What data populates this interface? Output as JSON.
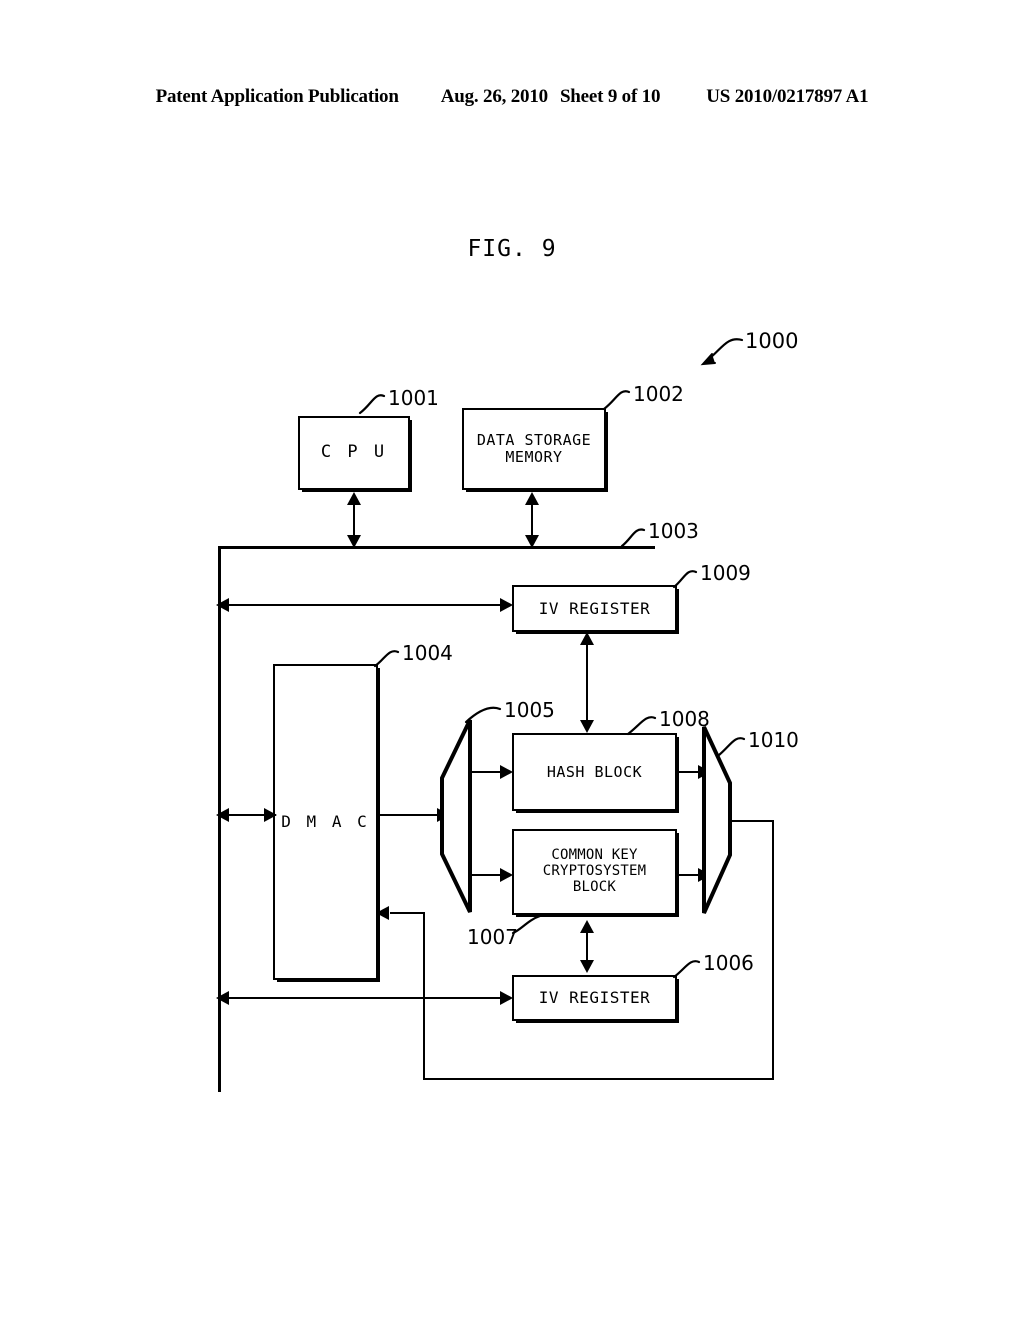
{
  "header": {
    "publication": "Patent Application Publication",
    "date": "Aug. 26, 2010",
    "sheet": "Sheet 9 of 10",
    "patent_number": "US 2010/0217897 A1"
  },
  "figure": {
    "title": "FIG. 9",
    "system_ref": "1000"
  },
  "blocks": {
    "cpu": {
      "label": "C P U",
      "ref": "1001"
    },
    "memory": {
      "label": "DATA STORAGE\nMEMORY",
      "ref": "1002"
    },
    "bus": {
      "label": "",
      "ref": "1003"
    },
    "dmac": {
      "label": "D M A C",
      "ref": "1004"
    },
    "demux": {
      "label": "",
      "ref": "1005"
    },
    "iv_reg_bottom": {
      "label": "IV REGISTER",
      "ref": "1006"
    },
    "crypto": {
      "label": "COMMON KEY\nCRYPTOSYSTEM\nBLOCK",
      "ref": "1007"
    },
    "hash": {
      "label": "HASH BLOCK",
      "ref": "1008"
    },
    "iv_reg_top": {
      "label": "IV REGISTER",
      "ref": "1009"
    },
    "mux": {
      "label": "",
      "ref": "1010"
    }
  },
  "colors": {
    "ink": "#000000",
    "paper": "#ffffff"
  }
}
